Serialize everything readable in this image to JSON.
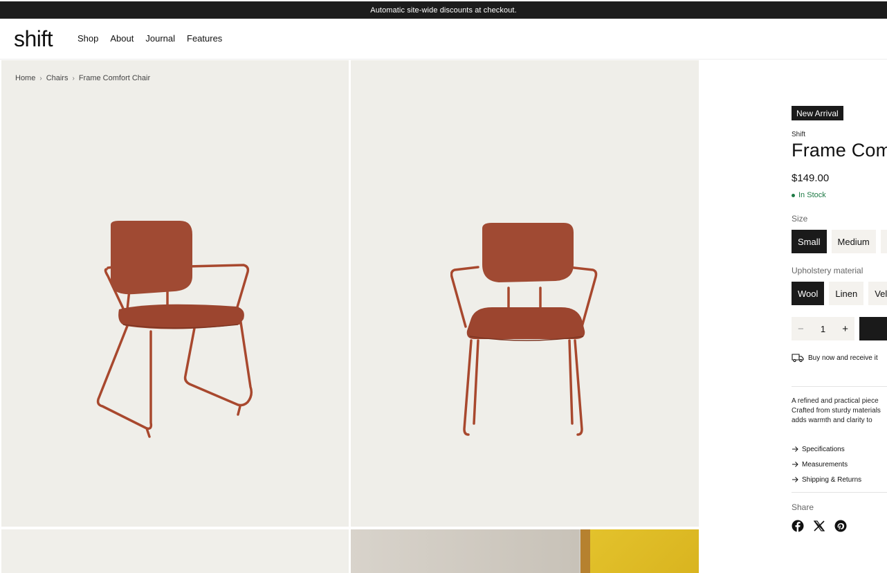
{
  "announcement": "Automatic site-wide discounts at checkout.",
  "header": {
    "logo": "shift",
    "nav": [
      "Shop",
      "About",
      "Journal",
      "Features"
    ]
  },
  "breadcrumb": [
    "Home",
    "Chairs",
    "Frame Comfort Chair"
  ],
  "product": {
    "badge": "New Arrival",
    "vendor": "Shift",
    "title": "Frame Comfort Chair",
    "price": "$149.00",
    "stock": "In Stock",
    "size_label": "Size",
    "sizes": [
      "Small",
      "Medium"
    ],
    "selected_size": "Small",
    "material_label": "Upholstery material",
    "materials": [
      "Wool",
      "Linen",
      "Velvet"
    ],
    "selected_material": "Wool",
    "quantity": "1",
    "shipping_note": "Buy now and receive it",
    "description": [
      "A refined and practical piece",
      "Crafted from sturdy materials",
      "adds warmth and clarity to"
    ],
    "accordions": [
      "Specifications",
      "Measurements",
      "Shipping & Returns"
    ],
    "share_label": "Share",
    "social": [
      "facebook-icon",
      "x-icon",
      "pinterest-icon"
    ]
  },
  "colors": {
    "accent": "#1a1a1a",
    "stock_green": "#1e7a45",
    "chair": "#a8482e",
    "panel_bg": "#efeee9"
  }
}
